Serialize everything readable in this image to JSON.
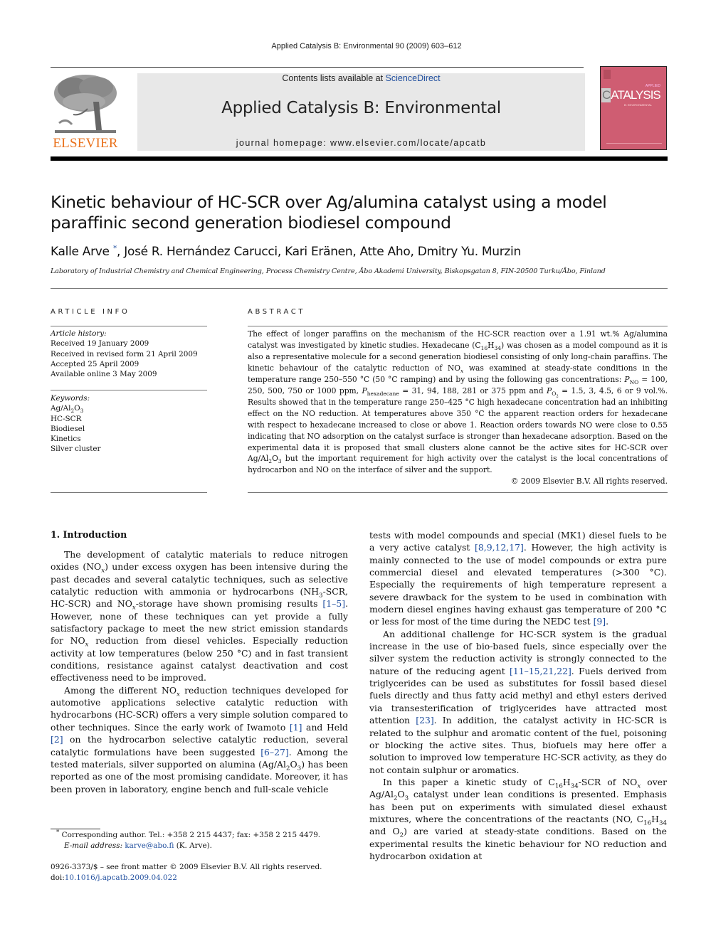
{
  "header": {
    "citation": "Applied Catalysis B: Environmental 90 (2009) 603–612",
    "contents_prefix": "Contents lists available at ",
    "contents_link": "ScienceDirect",
    "journal_title": "Applied Catalysis B: Environmental",
    "homepage": "journal homepage: www.elsevier.com/locate/apcatb",
    "publisher_logo_text": "ELSEVIER",
    "cover": {
      "applied": "APPLIED",
      "title_first": "C",
      "title_rest": "ATALYSIS",
      "subtitle": "B: ENVIRONMENTAL",
      "color": "#cf5d72"
    },
    "brand_color": "#e9711c",
    "link_color": "#1f4e9e"
  },
  "article": {
    "title_line1": "Kinetic behaviour of HC-SCR over Ag/alumina catalyst using a model",
    "title_line2": "paraffinic second generation biodiesel compound",
    "authors": [
      {
        "name": "Kalle Arve",
        "mark": "*"
      },
      {
        "name": "José R. Hernández Carucci"
      },
      {
        "name": "Kari Eränen"
      },
      {
        "name": "Atte Aho"
      },
      {
        "name": "Dmitry Yu. Murzin"
      }
    ],
    "affiliation": "Laboratory of Industrial Chemistry and Chemical Engineering, Process Chemistry Centre, Åbo Akademi University, Biskopsgatan 8, FIN-20500 Turku/Åbo, Finland"
  },
  "article_info": {
    "heading": "ARTICLE INFO",
    "history_label": "Article history:",
    "history": [
      "Received 19 January 2009",
      "Received in revised form 21 April 2009",
      "Accepted 25 April 2009",
      "Available online 3 May 2009"
    ],
    "keywords_label": "Keywords:",
    "keywords": [
      "Ag/Al2O3",
      "HC-SCR",
      "Biodiesel",
      "Kinetics",
      "Silver cluster"
    ]
  },
  "abstract": {
    "heading": "ABSTRACT",
    "s1": "The effect of longer paraffins on the mechanism of the HC-SCR reaction over a 1.91 wt.% Ag/alumina catalyst was investigated by kinetic studies. Hexadecane (C",
    "s1b": "16",
    "s1c": "H",
    "s1d": "34",
    "s2": ") was chosen as a model compound as it is also a representative molecule for a second generation biodiesel consisting of only long-chain paraffins. The kinetic behaviour of the catalytic reduction of NO",
    "s2x": "x",
    "s3": " was examined at steady-state conditions in the temperature range 250–550 °C (50 °C ramping) and by using the following gas concentrations: ",
    "p_no_label": "P",
    "p_no_sub": "NO",
    "p_no_vals": " = 100, 250, 500, 750 or 1000 ppm, ",
    "p_hex_label": "P",
    "p_hex_sub": "hexadecane",
    "p_hex_vals": " = 31, 94, 188, 281 or 375 ppm and ",
    "p_o2_label": "P",
    "p_o2_sub": "O2",
    "p_o2_vals": " = 1.5, 3, 4.5, 6 or 9 vol.%. ",
    "s4": "Results showed that in the temperature range 250–425 °C high hexadecane concentration had an inhibiting effect on the NO reduction. At temperatures above 350 °C the apparent reaction orders for hexadecane with respect to hexadecane increased to close or above 1. Reaction orders towards NO were close to 0.55 indicating that NO adsorption on the catalyst surface is stronger than hexadecane adsorption. Based on the experimental data it is proposed that small clusters alone cannot be the active sites for HC-SCR over Ag/Al",
    "s4b": "2",
    "s4c": "O",
    "s4d": "3",
    "s5": " but the important requirement for high activity over the catalyst is the local concentrations of hydrocarbon and NO on the interface of silver and the support.",
    "copyright": "© 2009 Elsevier B.V. All rights reserved."
  },
  "body": {
    "section_heading": "1.  Introduction",
    "col1": {
      "p1a": "The development of catalytic materials to reduce nitrogen oxides (NO",
      "p1b": ") under excess oxygen has been intensive during the past decades and several catalytic techniques, such as selective catalytic reduction with ammonia or hydrocarbons (NH",
      "p1c": "-SCR, HC-SCR) and NO",
      "p1d": "-storage have shown promising results ",
      "p1ref": "[1–5]",
      "p1e": ". However, none of these techniques can yet provide a fully satisfactory package to meet the new strict emission standards for NO",
      "p1f": " reduction from diesel vehicles. Especially reduction activity at low temperatures (below 250 °C) and in fast transient conditions, resistance against catalyst deactivation and cost effectiveness need to be improved.",
      "p2a": "Among the different NO",
      "p2b": " reduction techniques developed for automotive applications selective catalytic reduction with hydrocarbons (HC-SCR) offers a very simple solution compared to other techniques. Since the early work of Iwamoto ",
      "p2ref1": "[1]",
      "p2c": " and Held ",
      "p2ref2": "[2]",
      "p2d": " on the hydrocarbon selective catalytic reduction, several catalytic formulations have been suggested ",
      "p2ref3": "[6–27]",
      "p2e": ". Among the tested materials, silver supported on alumina (Ag/Al",
      "p2f": "O",
      "p2g": ") has been reported as one of the most promising candidate. Moreover, it has been proven in laboratory, engine bench and full-scale vehicle"
    },
    "col2": {
      "p1a": "tests with model compounds and special (MK1) diesel fuels to be a very active catalyst ",
      "p1ref1": "[8,9,12,17]",
      "p1b": ". However, the high activity is mainly connected to the use of model compounds or extra pure commercial diesel and elevated temperatures (>300 °C). Especially the requirements of high temperature represent a severe drawback for the system to be used in combination with modern diesel engines having exhaust gas temperature of 200 °C or less for most of the time during the NEDC test ",
      "p1ref2": "[9]",
      "p1c": ".",
      "p2a": "An additional challenge for HC-SCR system is the gradual increase in the use of bio-based fuels, since especially over the silver system the reduction activity is strongly connected to the nature of the reducing agent ",
      "p2ref1": "[11–15,21,22]",
      "p2b": ". Fuels derived from triglycerides can be used as substitutes for fossil based diesel fuels directly and thus fatty acid methyl and ethyl esters derived via transesterification of triglycerides have attracted most attention ",
      "p2ref2": "[23]",
      "p2c": ". In addition, the catalyst activity in HC-SCR is related to the sulphur and aromatic content of the fuel, poisoning or blocking the active sites. Thus, biofuels may here offer a solution to improved low temperature HC-SCR activity, as they do not contain sulphur or aromatics.",
      "p3a": "In this paper a kinetic study of C",
      "p3b": "-SCR of NO",
      "p3c": " over Ag/Al",
      "p3d": " catalyst under lean conditions is presented. Emphasis has been put on experiments with simulated diesel exhaust mixtures, where the concentrations of the reactants (NO, C",
      "p3e": " and O",
      "p3f": ") are varied at steady-state conditions. Based on the experimental results the kinetic behaviour for NO reduction and hydrocarbon oxidation at"
    }
  },
  "footnotes": {
    "mark": "*",
    "corresponding": "Corresponding author. Tel.: +358 2 215 4437; fax: +358 2 215 4479.",
    "email_label": "E-mail address: ",
    "email": "karve@abo.fi",
    "email_suffix": " (K. Arve).",
    "front_matter": "0926-3373/$ – see front matter © 2009 Elsevier B.V. All rights reserved.",
    "doi_label": "doi:",
    "doi": "10.1016/j.apcatb.2009.04.022"
  }
}
